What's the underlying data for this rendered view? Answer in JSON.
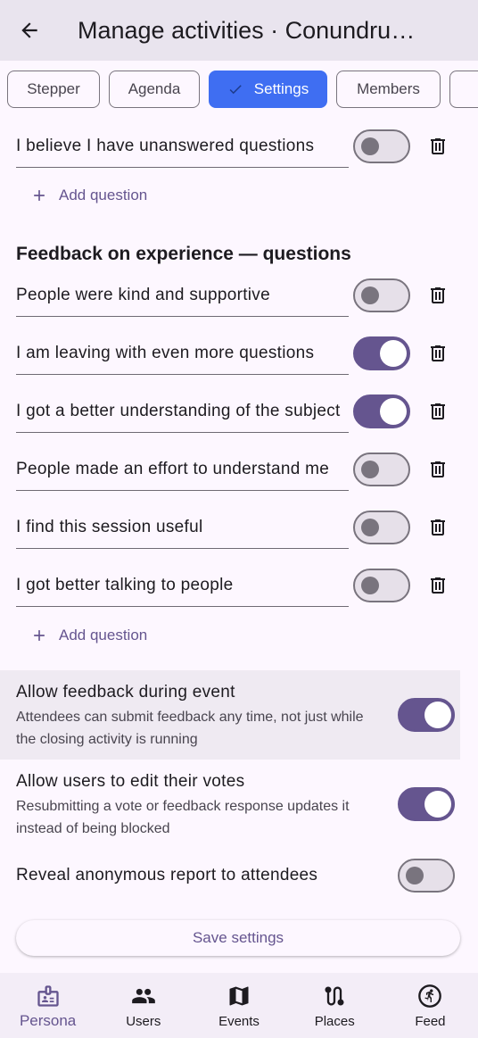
{
  "appbar": {
    "title": "Manage activities · Conundrum C...",
    "back_icon": "arrow-back-icon"
  },
  "tabs": [
    {
      "label": "Stepper",
      "selected": false
    },
    {
      "label": "Agenda",
      "selected": false
    },
    {
      "label": "Settings",
      "selected": true
    },
    {
      "label": "Members",
      "selected": false
    },
    {
      "label": "",
      "selected": false
    }
  ],
  "pre_questions": [
    {
      "text": "I believe I have unanswered questions",
      "enabled": false
    }
  ],
  "add_question_label": "Add question",
  "feedback_section": {
    "title": "Feedback on experience — questions",
    "questions": [
      {
        "text": "People were kind and supportive",
        "enabled": false
      },
      {
        "text": "I am leaving with even more questions",
        "enabled": true
      },
      {
        "text": "I got a better understanding of the subject",
        "enabled": true
      },
      {
        "text": "People made an effort to understand me",
        "enabled": false
      },
      {
        "text": "I find this session useful",
        "enabled": false
      },
      {
        "text": "I got better talking to people",
        "enabled": false
      }
    ],
    "add_question_label": "Add question"
  },
  "settings": [
    {
      "title": "Allow feedback during event",
      "subtitle": "Attendees can submit feedback any time, not just while the closing activity is running",
      "enabled": true
    },
    {
      "title": "Allow users to edit their votes",
      "subtitle": "Resubmitting a vote or feedback response updates it instead of being blocked",
      "enabled": true
    },
    {
      "title": "Reveal anonymous report to attendees",
      "subtitle": "",
      "enabled": false
    }
  ],
  "save_button_label": "Save settings",
  "bottom_nav": [
    {
      "label": "Persona",
      "icon": "badge-icon",
      "active": true
    },
    {
      "label": "Users",
      "icon": "group-icon",
      "active": false
    },
    {
      "label": "Events",
      "icon": "map-icon",
      "active": false
    },
    {
      "label": "Places",
      "icon": "route-icon",
      "active": false
    },
    {
      "label": "Feed",
      "icon": "directions-run-icon",
      "active": false
    }
  ],
  "colors": {
    "primary": "#65558f",
    "selected_tab": "#3f6ef2",
    "background": "#fdf7ff",
    "appbar": "#e9e4ee"
  }
}
